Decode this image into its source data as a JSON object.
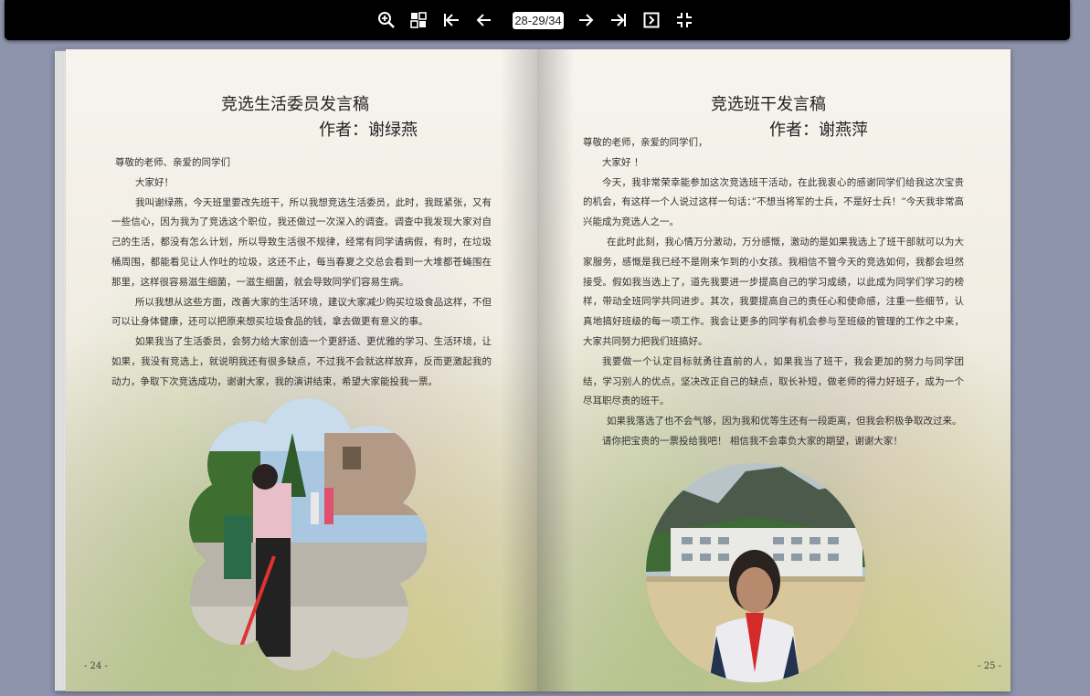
{
  "toolbar": {
    "icons": [
      "zoom-in-icon",
      "thumbnails-icon",
      "first-page-icon",
      "previous-page-icon",
      "next-page-icon",
      "last-page-icon",
      "single-page-icon",
      "fullscreen-icon"
    ],
    "page_indicator": "28-29/34"
  },
  "left_page": {
    "title": "竞选生活委员发言稿",
    "author": "作者：谢绿燕",
    "paragraphs": [
      "尊敬的老师、亲爱的同学们",
      "大家好！",
      "我叫谢绿燕，今天班里要改先班干，所以我想竞选生活委员，此时，我既紧张，又有一些信心，因为我为了竞选这个职位，我还做过一次深入的调查。调查中我发现大家对自己的生活，都没有怎么计划，所以导致生活很不规律，经常有同学请病假，有时，在垃圾桶周围，都能看见让人作吐的垃圾，这还不止，每当春夏之交总会看到一大堆都苍蝇围在那里，这样很容易滋生细菌，一滋生细菌，就会导致同学们容易生病。",
      "所以我想从这些方面，改善大家的生活环境，建议大家减少购买垃圾食品这样，不但可以让身体健康，还可以把原来想买垃圾食品的钱，拿去做更有意义的事。",
      "如果我当了生活委员，会努力给大家创造一个更舒适、更优雅的学习、生活环境，让如果，我没有竞选上，就说明我还有很多缺点，不过我不会就这样放弃，反而更激起我的动力，争取下次竞选成功，谢谢大家，我的演讲结束，希望大家能投我一票。"
    ],
    "folio": "- 24 -"
  },
  "right_page": {
    "title": "竞选班干发言稿",
    "author": "作者：谢燕萍",
    "paragraphs": [
      "尊敬的老师，亲爱的同学们，",
      "大家好 ！",
      "今天，我非常荣幸能参加这次竞选班干活动，在此我衷心的感谢同学们给我这次宝贵的机会，有这样一个人说过这样一句话：”不想当将军的士兵，不是好士兵！”今天我非常高兴能成为竞选人之一。",
      "在此时此刻，我心情万分激动，万分感慨，激动的是如果我选上了班干部就可以为大家服务，感慨是我已经不是刚来乍到的小女孩。我相信不管今天的竞选如何，我都会坦然接受。假如我当选上了，道先我要进一步提高自己的学习成绩，以此成为同学们学习的榜样，带动全班同学共同进步。其次，我要提高自己的责任心和使命感，注重一些细节，认真地搞好班级的每一项工作。我会让更多的同学有机会参与至班级的管理的工作之中来，大家共同努力把我们班搞好。",
      "我要做一个认定目标就勇往直前的人，如果我当了班干，我会更加的努力与同学团结，学习别人的优点，坚决改正自己的缺点，取长补短，做老师的得力好班子，成为一个尽耳职尽责的班干。",
      "如果我落选了也不会气够，因为我和优等生还有一段距离，但我会积极争取改过来。",
      "请你把宝贵的一票投给我吧！ 相信我不会辜负大家的期望，谢谢大家！"
    ],
    "folio": "- 25 -"
  }
}
